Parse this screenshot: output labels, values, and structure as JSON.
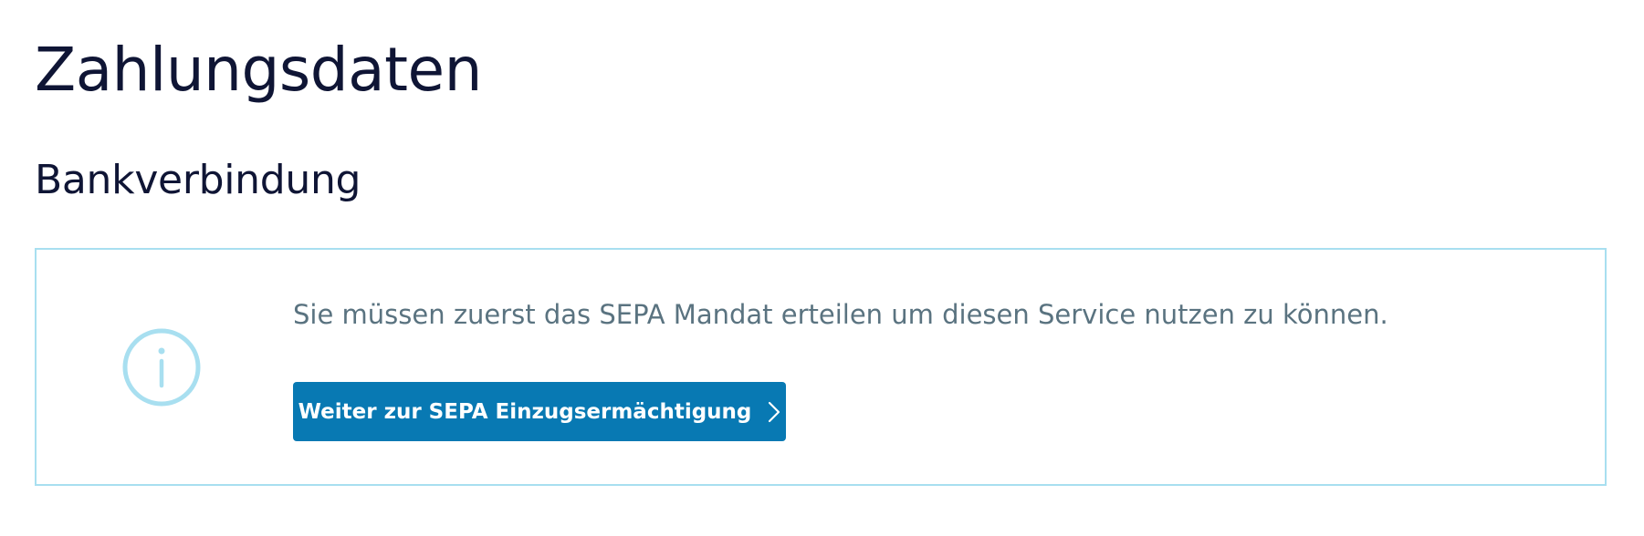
{
  "page": {
    "title": "Zahlungsdaten",
    "section_title": "Bankverbindung"
  },
  "info_box": {
    "icon": "info-circle-icon",
    "message": "Sie müssen zuerst das SEPA Mandat erteilen um diesen Service nutzen zu können.",
    "button_label": "Weiter zur SEPA Einzugsermächtigung",
    "button_icon": "chevron-right-icon"
  },
  "colors": {
    "heading": "#0f1535",
    "message_text": "#5a7380",
    "box_border": "#a8dff0",
    "info_icon": "#a8dff0",
    "button_bg": "#0879b3",
    "button_text": "#ffffff"
  }
}
